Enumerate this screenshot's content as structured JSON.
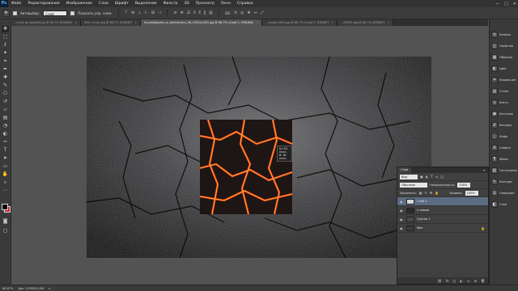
{
  "app": {
    "logo": "Ps"
  },
  "menubar": {
    "items": [
      "Файл",
      "Редактирование",
      "Изображение",
      "Слои",
      "Шрифт",
      "Выделение",
      "Фильтр",
      "3D",
      "Просмотр",
      "Окно",
      "Справка"
    ],
    "window_controls": [
      "—",
      "□",
      "✕"
    ]
  },
  "options": {
    "autoselect_label": "Автовыбор:",
    "autoselect_value": "Слой",
    "show_controls_label": "Показать упр. элем."
  },
  "doc_tabs": [
    {
      "label": "...crack on asphalt.jpg @ 66,7% (RGB/8*)",
      "active": false
    },
    {
      "label": "950...xture.jpg @ 66,7% (RGB/8*)",
      "active": false
    },
    {
      "label": "hq-wallpapers_ru_abstraction_56_1920x1200.jpg @ 66,7% (Слой 1, RGB/8#)",
      "active": true
    },
    {
      "label": "...smoke_850.jpg @ 66,7% (Слой 1, RGB/8*)",
      "active": false
    },
    {
      "label": "...83302.jpg @ 66,7% (RGB/8*)",
      "active": false
    }
  ],
  "measure_tooltip": {
    "w": "Ш: 82 пикс.",
    "h": "В: 82 пикс."
  },
  "right_panel": {
    "items": [
      {
        "icon": "≡",
        "label": "Каналы"
      },
      {
        "icon": "◫",
        "label": "Свойства"
      },
      {
        "icon": "▦",
        "label": "Образцы"
      },
      {
        "icon": "◐",
        "label": "Цвет"
      },
      {
        "icon": "⌗",
        "label": "Коррекция"
      },
      {
        "icon": "▤",
        "label": "Стили"
      },
      {
        "icon": "⌂",
        "label": "Кисть"
      },
      {
        "icon": "◉",
        "label": "Источник"
      },
      {
        "icon": "⇵",
        "label": "История"
      },
      {
        "icon": "ⓘ",
        "label": "Инфо"
      },
      {
        "icon": "A",
        "label": "Символ"
      },
      {
        "icon": "¶",
        "label": "Абзац"
      },
      {
        "icon": "▧",
        "label": "Гистограмма"
      },
      {
        "icon": "✎",
        "label": "Контуры"
      },
      {
        "icon": "☰",
        "label": "Операции"
      },
      {
        "icon": "◧",
        "label": "Слои"
      }
    ]
  },
  "layers_panel": {
    "tab": "Слои",
    "filter_value": "Вид",
    "blend_mode": "Обычные",
    "opacity_label": "Непрозрачность:",
    "opacity_value": "100%",
    "lock_label": "Закрепить:",
    "fill_label": "Заливка:",
    "fill_value": "100%",
    "layers": [
      {
        "name": "Слой 1",
        "selected": true,
        "thumb": "#d8d8d8"
      },
      {
        "name": "к новым",
        "selected": false,
        "thumb": "#2a2a2a"
      },
      {
        "name": "Группа 1",
        "selected": false,
        "thumb": "#4a4a4a"
      },
      {
        "name": "Фон",
        "selected": false,
        "thumb": "#3b3b3b"
      }
    ],
    "footer_icons": [
      "⛓",
      "fx",
      "◫",
      "◐",
      "▭",
      "⊞",
      "🗑"
    ]
  },
  "statusbar": {
    "zoom": "66,67%",
    "doc_info": "Док: 5,93M/10,9M"
  },
  "colors": {
    "foreground": "#000000",
    "background": "#c92020"
  }
}
